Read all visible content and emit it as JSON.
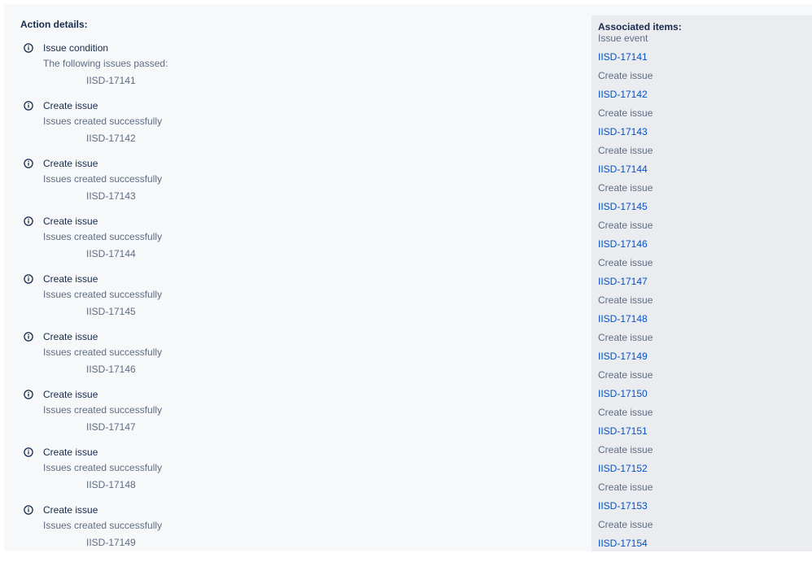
{
  "action_details": {
    "title": "Action details:",
    "items": [
      {
        "title": "Issue condition",
        "message": "The following issues passed:",
        "issue": "IISD-17141"
      },
      {
        "title": "Create issue",
        "message": "Issues created successfully",
        "issue": "IISD-17142"
      },
      {
        "title": "Create issue",
        "message": "Issues created successfully",
        "issue": "IISD-17143"
      },
      {
        "title": "Create issue",
        "message": "Issues created successfully",
        "issue": "IISD-17144"
      },
      {
        "title": "Create issue",
        "message": "Issues created successfully",
        "issue": "IISD-17145"
      },
      {
        "title": "Create issue",
        "message": "Issues created successfully",
        "issue": "IISD-17146"
      },
      {
        "title": "Create issue",
        "message": "Issues created successfully",
        "issue": "IISD-17147"
      },
      {
        "title": "Create issue",
        "message": "Issues created successfully",
        "issue": "IISD-17148"
      },
      {
        "title": "Create issue",
        "message": "Issues created successfully",
        "issue": "IISD-17149"
      }
    ]
  },
  "associated_items": {
    "title": "Associated items:",
    "items": [
      {
        "label": "Issue event",
        "kind": "event"
      },
      {
        "label": "IISD-17141",
        "kind": "link"
      },
      {
        "label": "Create issue",
        "kind": "event"
      },
      {
        "label": "IISD-17142",
        "kind": "link"
      },
      {
        "label": "Create issue",
        "kind": "event"
      },
      {
        "label": "IISD-17143",
        "kind": "link"
      },
      {
        "label": "Create issue",
        "kind": "event"
      },
      {
        "label": "IISD-17144",
        "kind": "link"
      },
      {
        "label": "Create issue",
        "kind": "event"
      },
      {
        "label": "IISD-17145",
        "kind": "link"
      },
      {
        "label": "Create issue",
        "kind": "event"
      },
      {
        "label": "IISD-17146",
        "kind": "link"
      },
      {
        "label": "Create issue",
        "kind": "event"
      },
      {
        "label": "IISD-17147",
        "kind": "link"
      },
      {
        "label": "Create issue",
        "kind": "event"
      },
      {
        "label": "IISD-17148",
        "kind": "link"
      },
      {
        "label": "Create issue",
        "kind": "event"
      },
      {
        "label": "IISD-17149",
        "kind": "link"
      },
      {
        "label": "Create issue",
        "kind": "event"
      },
      {
        "label": "IISD-17150",
        "kind": "link"
      },
      {
        "label": "Create issue",
        "kind": "event"
      },
      {
        "label": "IISD-17151",
        "kind": "link"
      },
      {
        "label": "Create issue",
        "kind": "event"
      },
      {
        "label": "IISD-17152",
        "kind": "link"
      },
      {
        "label": "Create issue",
        "kind": "event"
      },
      {
        "label": "IISD-17153",
        "kind": "link"
      },
      {
        "label": "Create issue",
        "kind": "event"
      },
      {
        "label": "IISD-17154",
        "kind": "link"
      }
    ]
  },
  "icons": {
    "action_status": "info-icon"
  },
  "colors": {
    "heading": "#172b4d",
    "secondary_text": "#5e6c84",
    "link": "#0052cc",
    "panel_bg": "#f7f8fa",
    "sidebar_bg": "#ebecf0"
  }
}
